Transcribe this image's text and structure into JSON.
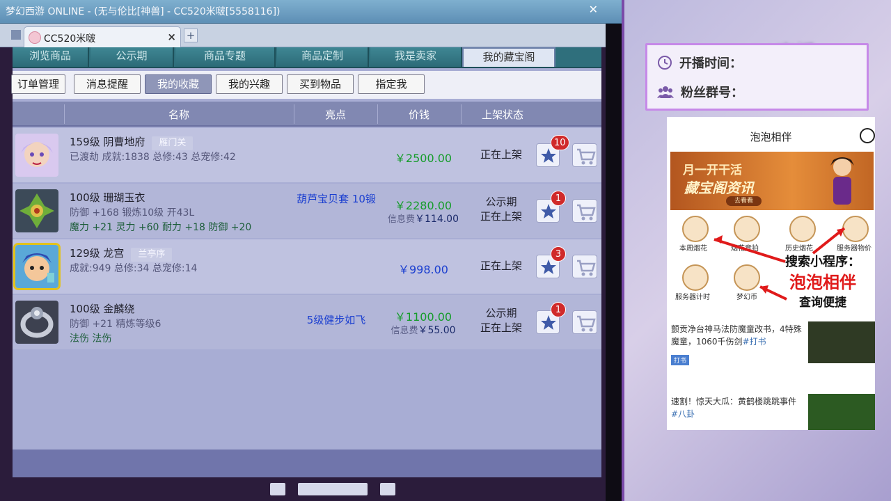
{
  "window": {
    "title": "梦幻西游 ONLINE - (无与伦比[神兽] - CC520米啵[5558116])",
    "tab_title": "CC520米啵"
  },
  "top_tabs": [
    "浏览商品",
    "公示期",
    "商品专题",
    "商品定制",
    "我是卖家",
    "我的藏宝阁"
  ],
  "sub_tabs": [
    "订单管理",
    "消息提醒",
    "我的收藏",
    "我的兴趣",
    "买到物品",
    "指定我"
  ],
  "columns": {
    "name": "名称",
    "highlight": "亮点",
    "price": "价钱",
    "status": "上架状态"
  },
  "items": [
    {
      "title": "159级 阴曹地府",
      "tag": "雁门关",
      "line2": "已渡劫 成就:1838 总修:43 总宠修:42",
      "line3": "",
      "highlight": "",
      "price": "￥2500.00",
      "fee": "",
      "status1": "正在上架",
      "status2": "",
      "badge": "10"
    },
    {
      "title": "100级 珊瑚玉衣",
      "tag": "",
      "line2": "防御 +168 锻炼10级 开43L",
      "line3": "魔力 +21 灵力 +60 耐力 +18 防御 +20",
      "highlight": "葫芦宝贝套 10锻",
      "price": "￥2280.00",
      "fee_label": "信息费",
      "fee": "￥114.00",
      "status1": "公示期",
      "status2": "正在上架",
      "badge": "1"
    },
    {
      "title": "129级 龙宫",
      "tag": "兰亭序",
      "line2": "成就:949 总修:34 总宠修:14",
      "line3": "",
      "highlight": "",
      "price": "￥998.00",
      "fee": "",
      "status1": "正在上架",
      "status2": "",
      "badge": "3"
    },
    {
      "title": "100级 金麟绕",
      "tag": "",
      "line2": "防御 +21 精炼等级6",
      "line3": "法伤 法伤",
      "highlight": "5级健步如飞",
      "price": "￥1100.00",
      "fee_label": "信息费",
      "fee": "￥55.00",
      "status1": "公示期",
      "status2": "正在上架",
      "badge": "1"
    }
  ],
  "stream_info": {
    "start_time_label": "开播时间：",
    "fan_group_label": "粉丝群号：",
    "logo": "CC直播"
  },
  "phone": {
    "title": "泡泡相伴",
    "banner_line1": "月一开干活",
    "banner_line2": "藏宝阁资讯",
    "banner_btn": "去看看",
    "grid": [
      "本周烟花",
      "烟花竞拍",
      "历史烟花",
      "服务器物价",
      "服务器计时",
      "梦幻币"
    ],
    "search_line1": "搜索小程序：",
    "search_line2": "泡泡相伴",
    "search_line3": "查询便捷",
    "news": [
      {
        "text": "颤贡净台神马法防魔童改书，4特殊魔童，1060千伤剑",
        "hashtag": "#打书",
        "tag": "打书"
      },
      {
        "text": "速割！惊天大瓜：黄鹤楼跳跳事件",
        "hashtag": "#八卦",
        "tag": ""
      }
    ]
  },
  "colors": {
    "accent": "#c689e8",
    "price_green": "#159c2a",
    "price_blue": "#1b3fd0",
    "badge_red": "#d02a2a"
  }
}
